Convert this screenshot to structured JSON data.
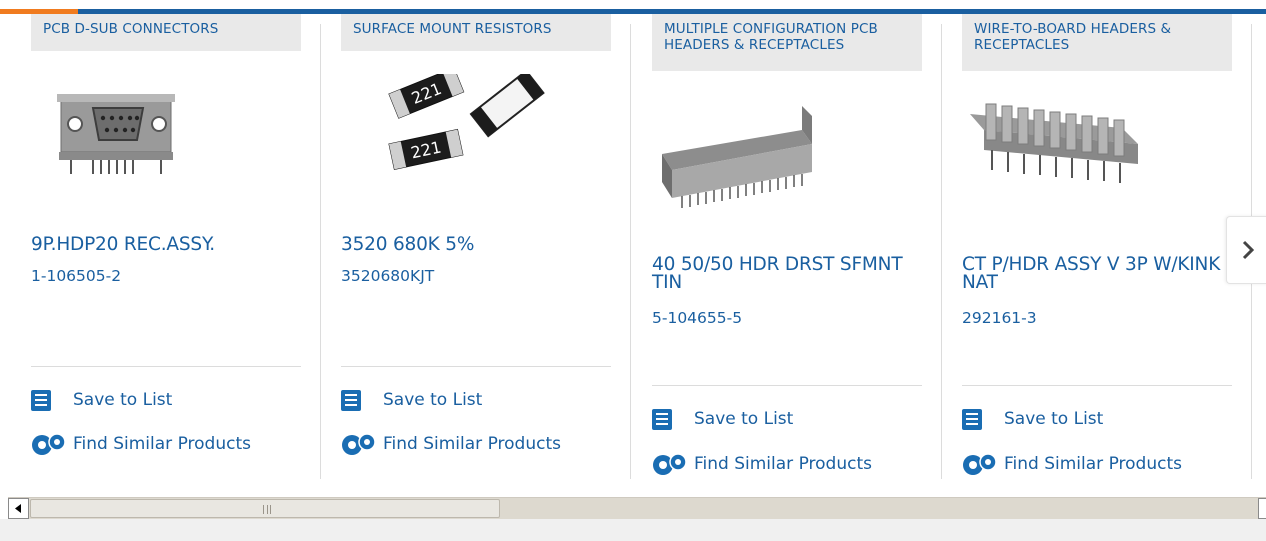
{
  "colors": {
    "brand_blue": "#1a5fa0",
    "accent_orange": "#f07b1f",
    "tag_bg": "#e9e9e9",
    "divider": "#dcdcdc"
  },
  "cards": [
    {
      "category": "PCB D-SUB CONNECTORS",
      "title": "9P.HDP20 REC.ASSY.",
      "part_number": "1-106505-2",
      "save_label": "Save to List",
      "similar_label": "Find Similar Products",
      "image": "d-sub-connector-image"
    },
    {
      "category": "SURFACE MOUNT RESISTORS",
      "title": "3520 680K 5%",
      "part_number": "3520680KJT",
      "save_label": "Save to List",
      "similar_label": "Find Similar Products",
      "image": "smd-resistor-image"
    },
    {
      "category": "MULTIPLE CONFIGURATION PCB HEADERS & RECEPTACLES",
      "title": "40 50/50 HDR DRST SFMNT TIN",
      "part_number": "5-104655-5",
      "save_label": "Save to List",
      "similar_label": "Find Similar Products",
      "image": "pcb-header-image"
    },
    {
      "category": "WIRE-TO-BOARD HEADERS & RECEPTACLES",
      "title": "CT P/HDR ASSY V 3P W/KINK NAT",
      "part_number": "292161-3",
      "save_label": "Save to List",
      "similar_label": "Find Similar Products",
      "image": "wire-to-board-header-image"
    }
  ],
  "next_arrow_icon": "chevron-right-icon",
  "resistor_marking": "221"
}
